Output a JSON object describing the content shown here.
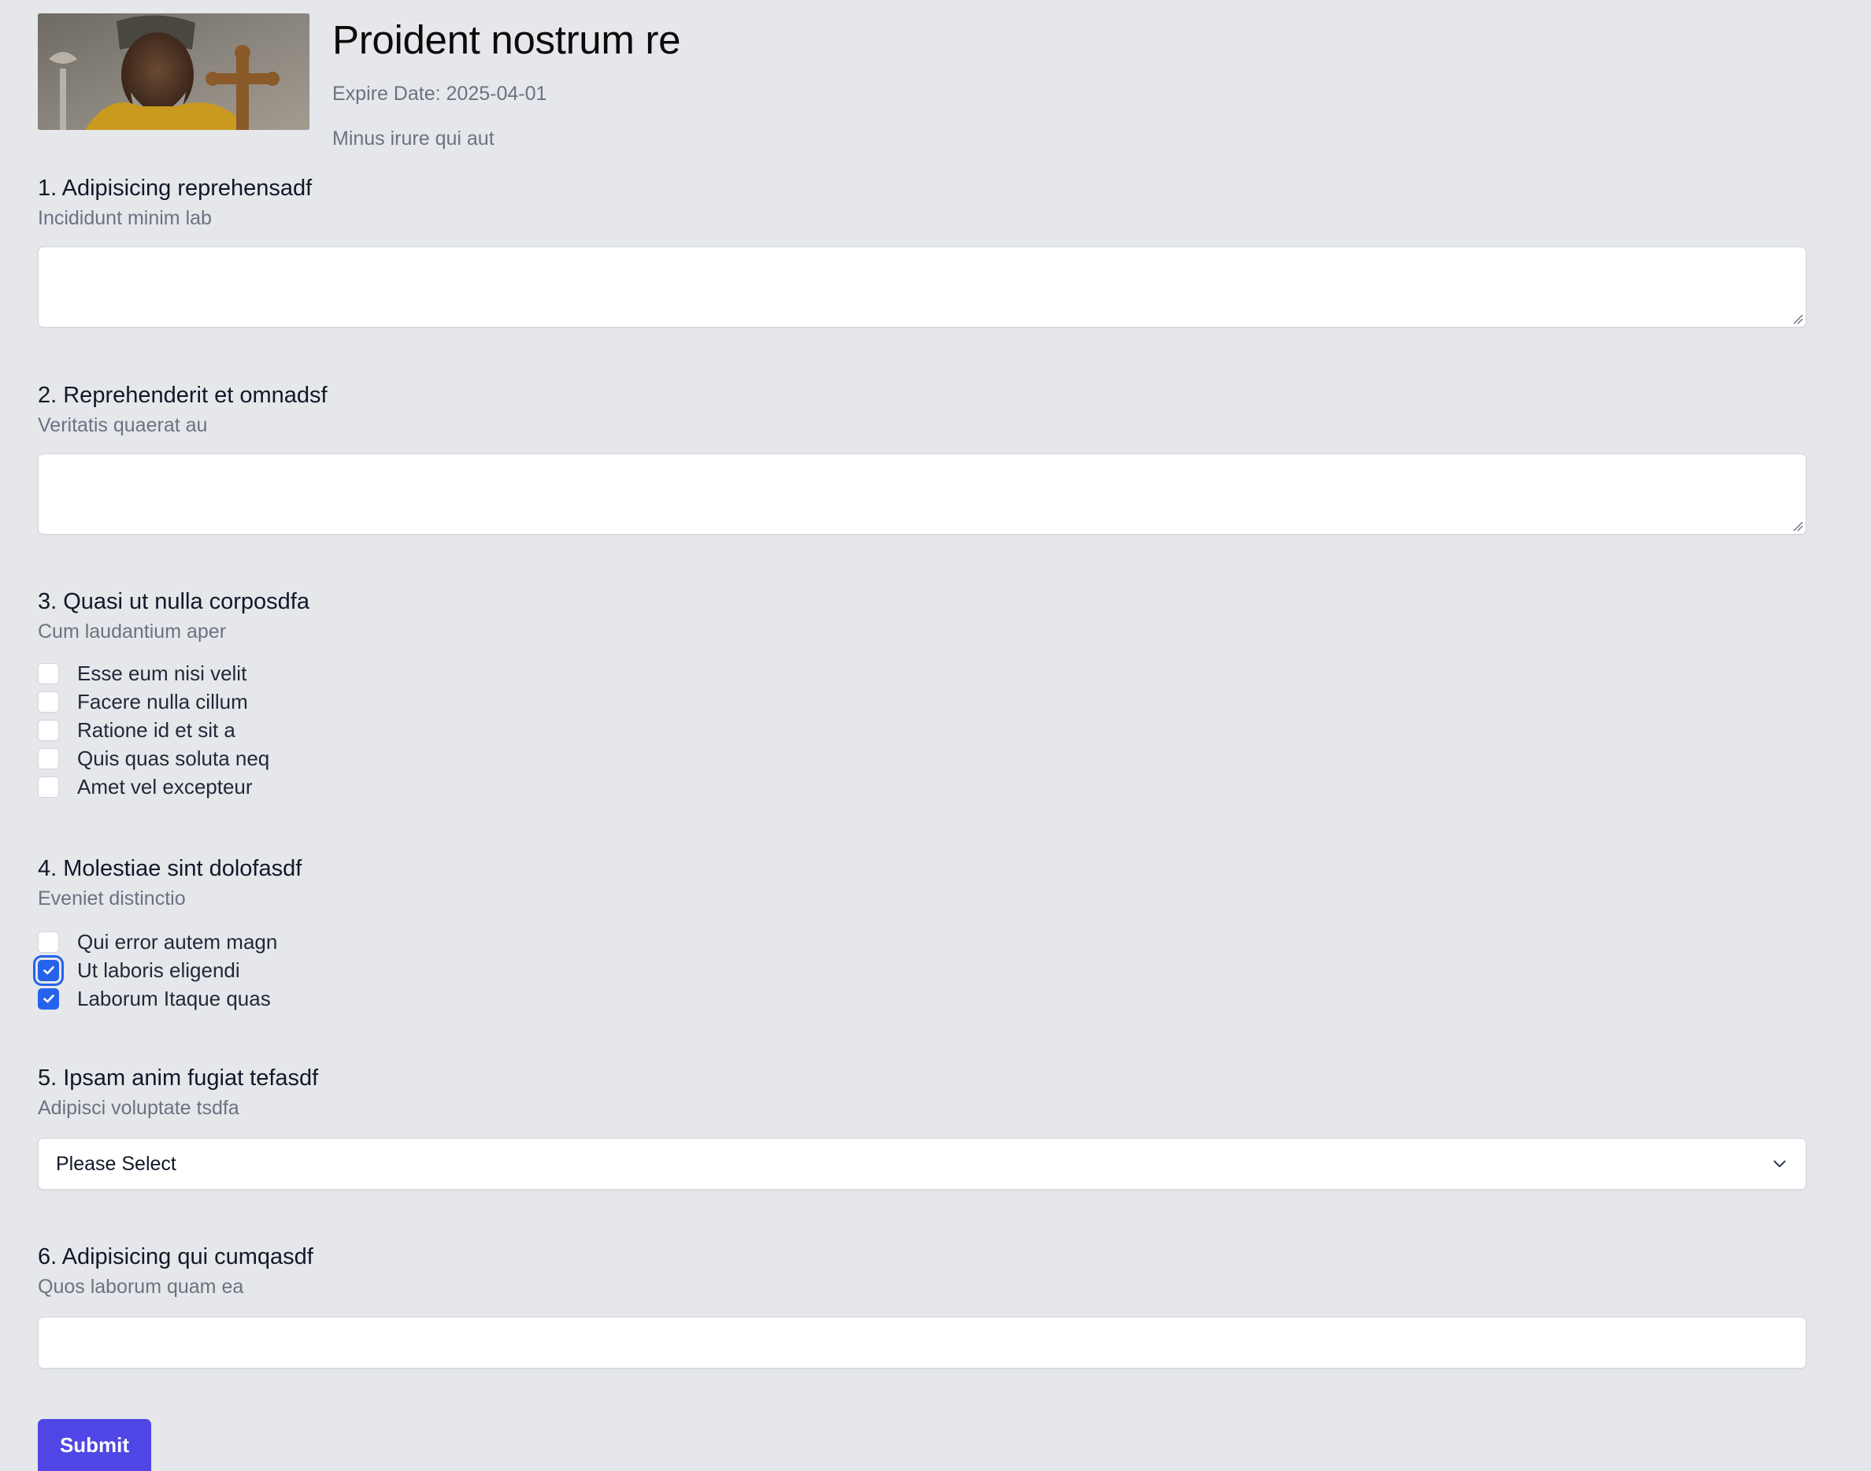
{
  "survey": {
    "title": "Proident nostrum re",
    "expire_date": "Expire Date: 2025-04-01",
    "subtitle": "Minus irure qui aut"
  },
  "questions": [
    {
      "title": "1. Adipisicing reprehensadf",
      "description": "Incididunt minim lab",
      "type": "textarea",
      "value": ""
    },
    {
      "title": "2. Reprehenderit et omnadsf",
      "description": "Veritatis quaerat au",
      "type": "textarea",
      "value": ""
    },
    {
      "title": "3. Quasi ut nulla corposdfa",
      "description": "Cum laudantium aper",
      "type": "checkbox",
      "options": [
        {
          "label": "Esse eum nisi velit",
          "checked": false
        },
        {
          "label": "Facere nulla cillum",
          "checked": false
        },
        {
          "label": "Ratione id et sit a",
          "checked": false
        },
        {
          "label": "Quis quas soluta neq",
          "checked": false
        },
        {
          "label": "Amet vel excepteur",
          "checked": false
        }
      ]
    },
    {
      "title": "4. Molestiae sint dolofasdf",
      "description": "Eveniet distinctio",
      "type": "checkbox",
      "options": [
        {
          "label": "Qui error autem magn",
          "checked": false
        },
        {
          "label": "Ut laboris eligendi",
          "checked": true
        },
        {
          "label": "Laborum Itaque quas",
          "checked": true
        }
      ]
    },
    {
      "title": "5. Ipsam anim fugiat tefasdf",
      "description": "Adipisci voluptate tsdfa",
      "type": "select",
      "selected": "Please Select"
    },
    {
      "title": "6. Adipisicing qui cumqasdf",
      "description": "Quos laborum quam ea",
      "type": "text",
      "value": ""
    }
  ],
  "actions": {
    "submit_label": "Submit"
  },
  "colors": {
    "background": "#e5e7eb",
    "checkbox_checked": "#2563eb",
    "submit_button": "#4f46e5",
    "muted_text": "#6b7280"
  },
  "icons": {
    "checkmark": "check-icon",
    "select_chevron": "chevron-down-icon",
    "textarea_resize": "resize-grip-icon"
  }
}
